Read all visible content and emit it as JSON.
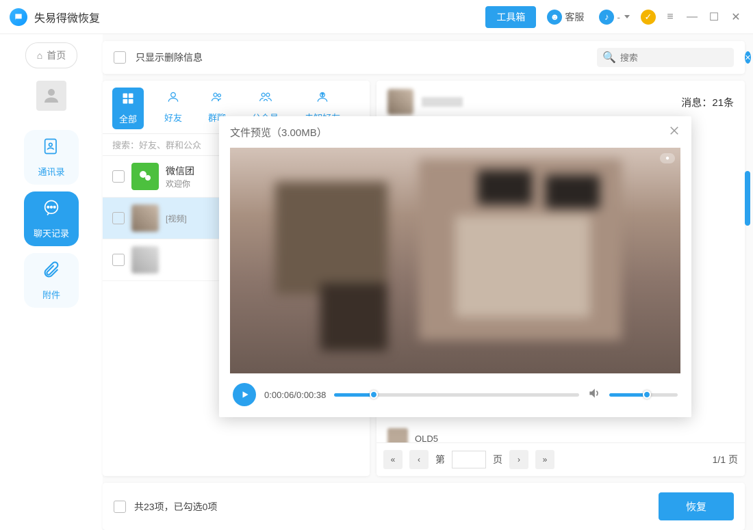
{
  "header": {
    "app_title": "失易得微恢复",
    "toolbox_btn": "工具箱",
    "customer_service": "客服"
  },
  "sidebar": {
    "home_label": "首页",
    "items": [
      {
        "label": "通讯录"
      },
      {
        "label": "聊天记录"
      },
      {
        "label": "附件"
      }
    ]
  },
  "topbar": {
    "show_deleted_label": "只显示删除信息",
    "search_placeholder": "搜索"
  },
  "tabs": [
    {
      "label": "全部"
    },
    {
      "label": "好友"
    },
    {
      "label": "群聊"
    },
    {
      "label": "公众号"
    },
    {
      "label": "未知好友"
    }
  ],
  "chat_search_placeholder": "搜索：好友、群和公众",
  "chats": [
    {
      "name": "微信团",
      "sub": "欢迎你"
    },
    {
      "name": "",
      "sub": "[视频]"
    },
    {
      "name": "",
      "sub": ""
    }
  ],
  "msg_header": {
    "count_label": "消息：",
    "count_value": "21条"
  },
  "msg_list": [
    {
      "name": "OLD5"
    }
  ],
  "pager": {
    "label_page_prefix": "第",
    "label_page_suffix": "页",
    "page_input": "",
    "total": "1/1 页"
  },
  "footer": {
    "summary": "共23项，已勾选0项",
    "recover_btn": "恢复"
  },
  "modal": {
    "title": "文件预览（3.00MB）",
    "time_text": "0:00:06/0:00:38"
  }
}
